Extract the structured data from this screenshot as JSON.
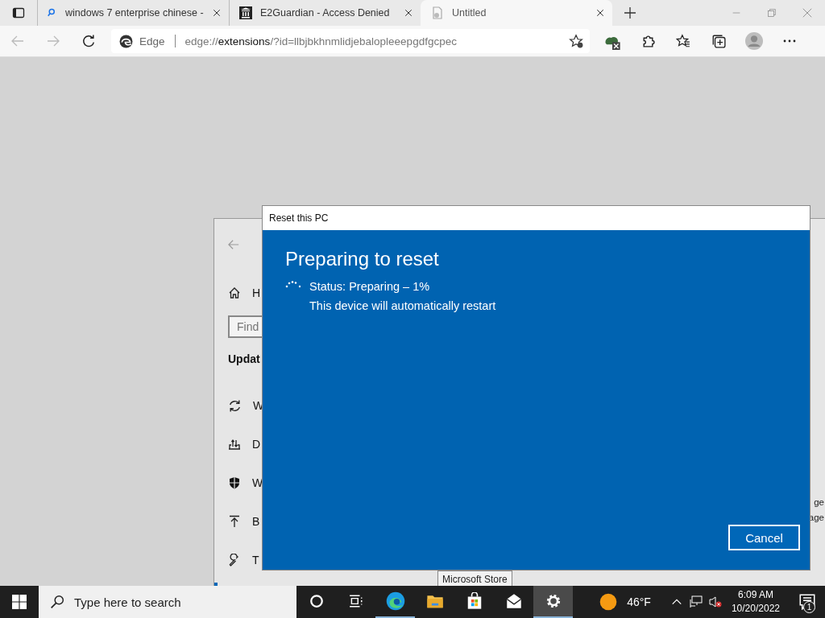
{
  "browser": {
    "tabs": [
      {
        "kind": "search",
        "title": "windows 7 enterprise chinese -",
        "selected": false
      },
      {
        "kind": "institution",
        "title": "E2Guardian - Access Denied",
        "selected": false
      },
      {
        "kind": "document",
        "title": "Untitled",
        "selected": true
      }
    ],
    "address_bar": {
      "site_label": "Edge",
      "url": "edge://**extensions**/?id=llbjbkhnmlidjebalopleeepgdfgcpec"
    }
  },
  "settings_window": {
    "nav_items": [
      {
        "kind": "home",
        "text": "H"
      }
    ],
    "search_placeholder": "Find",
    "section_title": "Updat",
    "items": [
      {
        "kind": "sync",
        "text": "W"
      },
      {
        "kind": "delivery",
        "text": "D"
      },
      {
        "kind": "shield",
        "text": "W"
      },
      {
        "kind": "backup",
        "text": "B"
      },
      {
        "kind": "wrench",
        "text": "T"
      }
    ],
    "right_texts": [
      "ge",
      "age"
    ]
  },
  "dialog": {
    "title": "Reset this PC",
    "heading": "Preparing to reset",
    "status": "Status: Preparing – 1%",
    "note": "This device will automatically restart",
    "cancel": "Cancel"
  },
  "tooltip": "Microsoft Store",
  "taskbar": {
    "search_placeholder": "Type here to search",
    "apps": [
      {
        "kind": "cortana",
        "running": false,
        "selected": false
      },
      {
        "kind": "taskview",
        "running": false,
        "selected": false
      },
      {
        "kind": "edge",
        "running": true,
        "selected": false
      },
      {
        "kind": "explorer",
        "running": false,
        "selected": false
      },
      {
        "kind": "store",
        "running": false,
        "selected": false
      },
      {
        "kind": "mail",
        "running": false,
        "selected": false
      },
      {
        "kind": "settings",
        "running": true,
        "selected": true
      }
    ],
    "temperature": "46°F",
    "time": "6:09 AM",
    "date": "10/20/2022",
    "notification_count": "1"
  }
}
